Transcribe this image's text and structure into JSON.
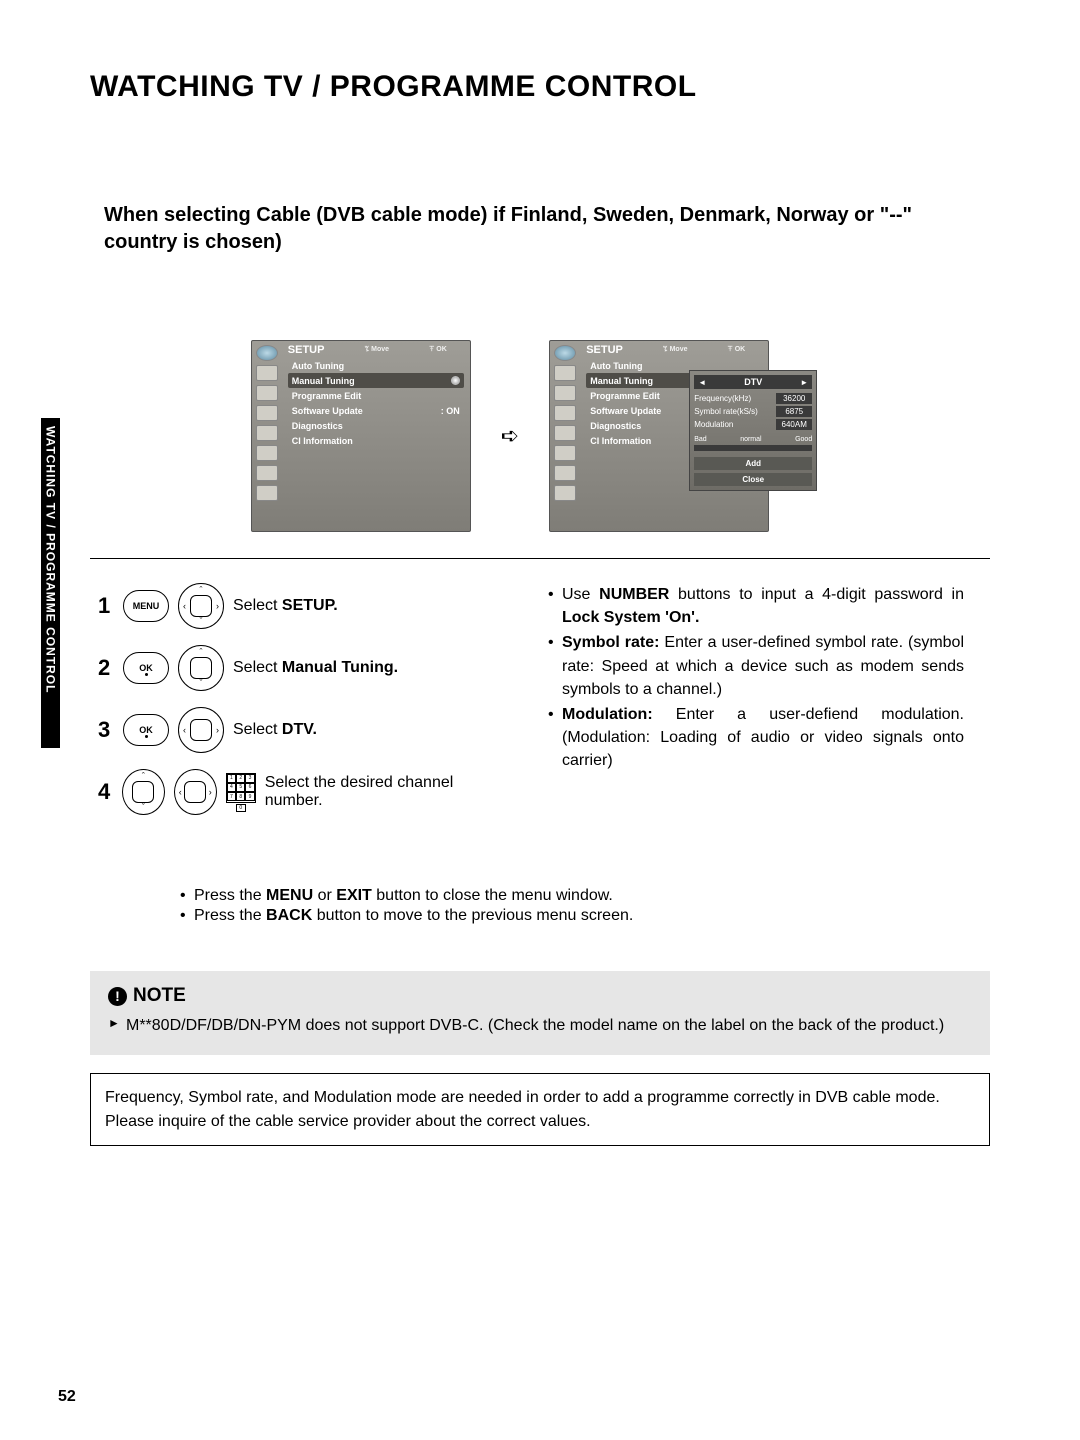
{
  "page_number": "52",
  "side_tab": "WATCHING TV / PROGRAMME CONTROL",
  "title": "WATCHING TV / PROGRAMME CONTROL",
  "subheading": "When selecting Cable (DVB cable mode) if Finland, Sweden, Denmark, Norway or \"--\" country is chosen)",
  "osd": {
    "header": "SETUP",
    "nav_move": "Move",
    "nav_ok": "OK",
    "items": {
      "auto_tuning": "Auto Tuning",
      "manual_tuning": "Manual Tuning",
      "programme_edit": "Programme Edit",
      "software_update": "Software Update",
      "software_update_value": ": ON",
      "diagnostics": "Diagnostics",
      "ci_information": "CI Information"
    },
    "panel": {
      "dtv": "DTV",
      "frequency_label": "Frequency(kHz)",
      "frequency_value": "36200",
      "symbol_label": "Symbol rate(kS/s)",
      "symbol_value": "6875",
      "modulation_label": "Modulation",
      "modulation_value": "640AM",
      "signal_bad": "Bad",
      "signal_normal": "normal",
      "signal_good": "Good",
      "add": "Add",
      "close": "Close"
    }
  },
  "steps": {
    "s1_btn": "MENU",
    "s1_text_a": "Select ",
    "s1_text_b": "SETUP.",
    "s2_btn": "OK",
    "s2_text_a": "Select ",
    "s2_text_b": "Manual Tuning.",
    "s3_btn": "OK",
    "s3_text_a": "Select ",
    "s3_text_b": "DTV.",
    "s4_text": "Select the desired channel number."
  },
  "right_notes": {
    "n1_a": "Use ",
    "n1_b": "NUMBER",
    "n1_c": " buttons to input a 4-digit password in ",
    "n1_d": "Lock System 'On'.",
    "n2_a": "Symbol rate:",
    "n2_b": " Enter a user-defined symbol rate. (symbol rate: Speed at which a device such as modem sends symbols to a channel.)",
    "n3_a": "Modulation:",
    "n3_b": " Enter a user-defiend modulation. (Modulation: Loading of audio or video signals onto carrier)"
  },
  "closing": {
    "c1_a": "Press the ",
    "c1_b": "MENU",
    "c1_c": " or ",
    "c1_d": "EXIT",
    "c1_e": " button to close the menu window.",
    "c2_a": "Press the ",
    "c2_b": "BACK",
    "c2_c": "  button to move to the previous menu screen."
  },
  "note": {
    "label": "NOTE",
    "body": "M**80D/DF/DB/DN-PYM does not support DVB-C. (Check the model name on the label on the back of the product.)"
  },
  "info_box": "Frequency, Symbol rate, and Modulation mode are needed in order to add a programme correctly in DVB cable mode. Please inquire of the cable service provider about the correct values."
}
